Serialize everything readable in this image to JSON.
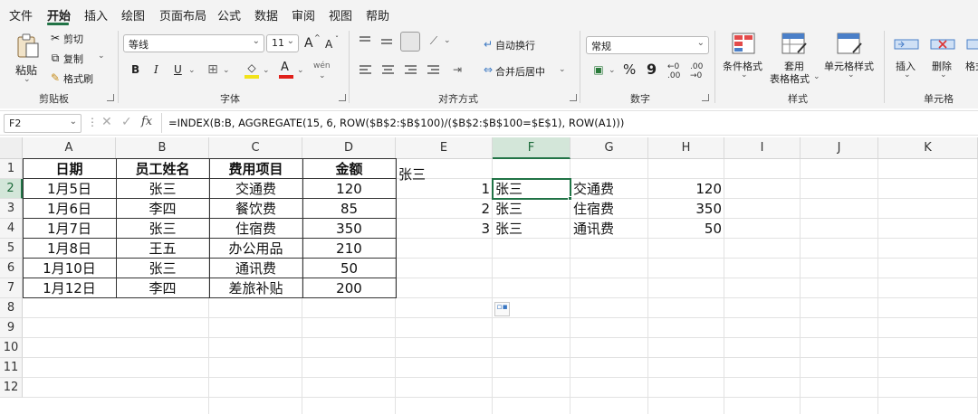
{
  "menu": {
    "items": [
      "文件",
      "开始",
      "插入",
      "绘图",
      "页面布局",
      "公式",
      "数据",
      "审阅",
      "视图",
      "帮助"
    ]
  },
  "ribbon": {
    "clipboard": {
      "paste": "粘贴",
      "cut": "剪切",
      "copy": "复制",
      "format_painter": "格式刷",
      "label": "剪贴板"
    },
    "font": {
      "name": "等线",
      "size": "11",
      "grow": "A",
      "shrink": "A",
      "bold": "B",
      "italic": "I",
      "underline": "U",
      "label": "字体"
    },
    "alignment": {
      "wrap": "自动换行",
      "merge": "合并后居中",
      "label": "对齐方式"
    },
    "number": {
      "format": "常规",
      "percent": "%",
      "comma": "9",
      "label": "数字"
    },
    "styles": {
      "conditional": "条件格式",
      "table_format_1": "套用",
      "table_format_2": "表格格式",
      "cell_styles": "单元格样式",
      "label": "样式"
    },
    "cells": {
      "insert": "插入",
      "delete": "删除",
      "format": "格式",
      "label": "单元格"
    }
  },
  "formula_bar": {
    "name_box": "F2",
    "fx": "fx",
    "formula": "=INDEX(B:B, AGGREGATE(15, 6, ROW($B$2:$B$100)/($B$2:$B$100=$E$1), ROW(A1)))"
  },
  "grid": {
    "columns": [
      "A",
      "B",
      "C",
      "D",
      "E",
      "F",
      "G",
      "H",
      "I",
      "J",
      "K"
    ],
    "rows": [
      "1",
      "2",
      "3",
      "4",
      "5",
      "6",
      "7",
      "8",
      "9",
      "10",
      "11",
      "12"
    ],
    "selected_cell": "F2",
    "table_headers": [
      "日期",
      "员工姓名",
      "费用项目",
      "金额"
    ],
    "table_rows": [
      [
        "1月5日",
        "张三",
        "交通费",
        "120"
      ],
      [
        "1月6日",
        "李四",
        "餐饮费",
        "85"
      ],
      [
        "1月7日",
        "张三",
        "住宿费",
        "350"
      ],
      [
        "1月8日",
        "王五",
        "办公用品",
        "210"
      ],
      [
        "1月10日",
        "张三",
        "通讯费",
        "50"
      ],
      [
        "1月12日",
        "李四",
        "差旅补贴",
        "200"
      ]
    ],
    "lookup_key": "张三",
    "results": [
      [
        "1",
        "张三",
        "交通费",
        "120"
      ],
      [
        "2",
        "张三",
        "住宿费",
        "350"
      ],
      [
        "3",
        "张三",
        "通讯费",
        "50"
      ]
    ]
  }
}
